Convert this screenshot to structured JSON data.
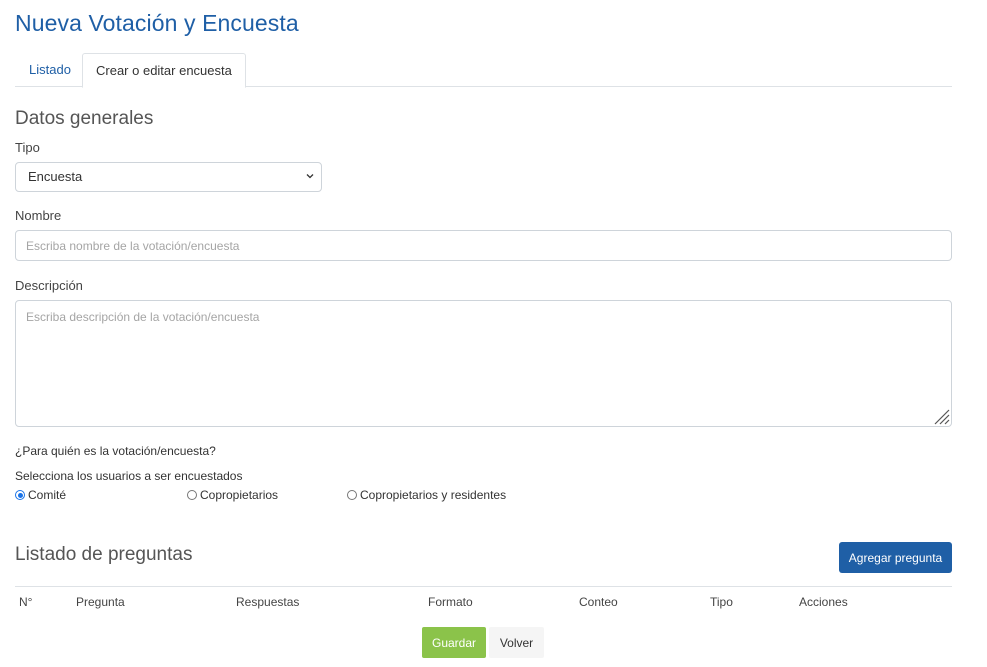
{
  "page": {
    "title": "Nueva Votación y Encuesta"
  },
  "tabs": [
    {
      "label": "Listado",
      "active": false
    },
    {
      "label": "Crear o editar encuesta",
      "active": true
    }
  ],
  "general": {
    "section_title": "Datos generales",
    "tipo_label": "Tipo",
    "tipo_value": "Encuesta",
    "nombre_label": "Nombre",
    "nombre_placeholder": "Escriba nombre de la votación/encuesta",
    "descripcion_label": "Descripción",
    "descripcion_placeholder": "Escriba descripción de la votación/encuesta"
  },
  "audience": {
    "question": "¿Para quién es la votación/encuesta?",
    "hint": "Selecciona los usuarios a ser encuestados",
    "options": [
      {
        "label": "Comité",
        "checked": true
      },
      {
        "label": "Copropietarios",
        "checked": false
      },
      {
        "label": "Copropietarios y residentes",
        "checked": false
      }
    ]
  },
  "questions": {
    "section_title": "Listado de preguntas",
    "add_button": "Agregar pregunta",
    "columns": [
      "N°",
      "Pregunta",
      "Respuestas",
      "Formato",
      "Conteo",
      "Tipo",
      "Acciones"
    ]
  },
  "actions": {
    "save_label": "Guardar",
    "back_label": "Volver"
  },
  "colors": {
    "primary": "#1f5fa6",
    "success": "#8bc34a",
    "border": "#ced4da"
  }
}
